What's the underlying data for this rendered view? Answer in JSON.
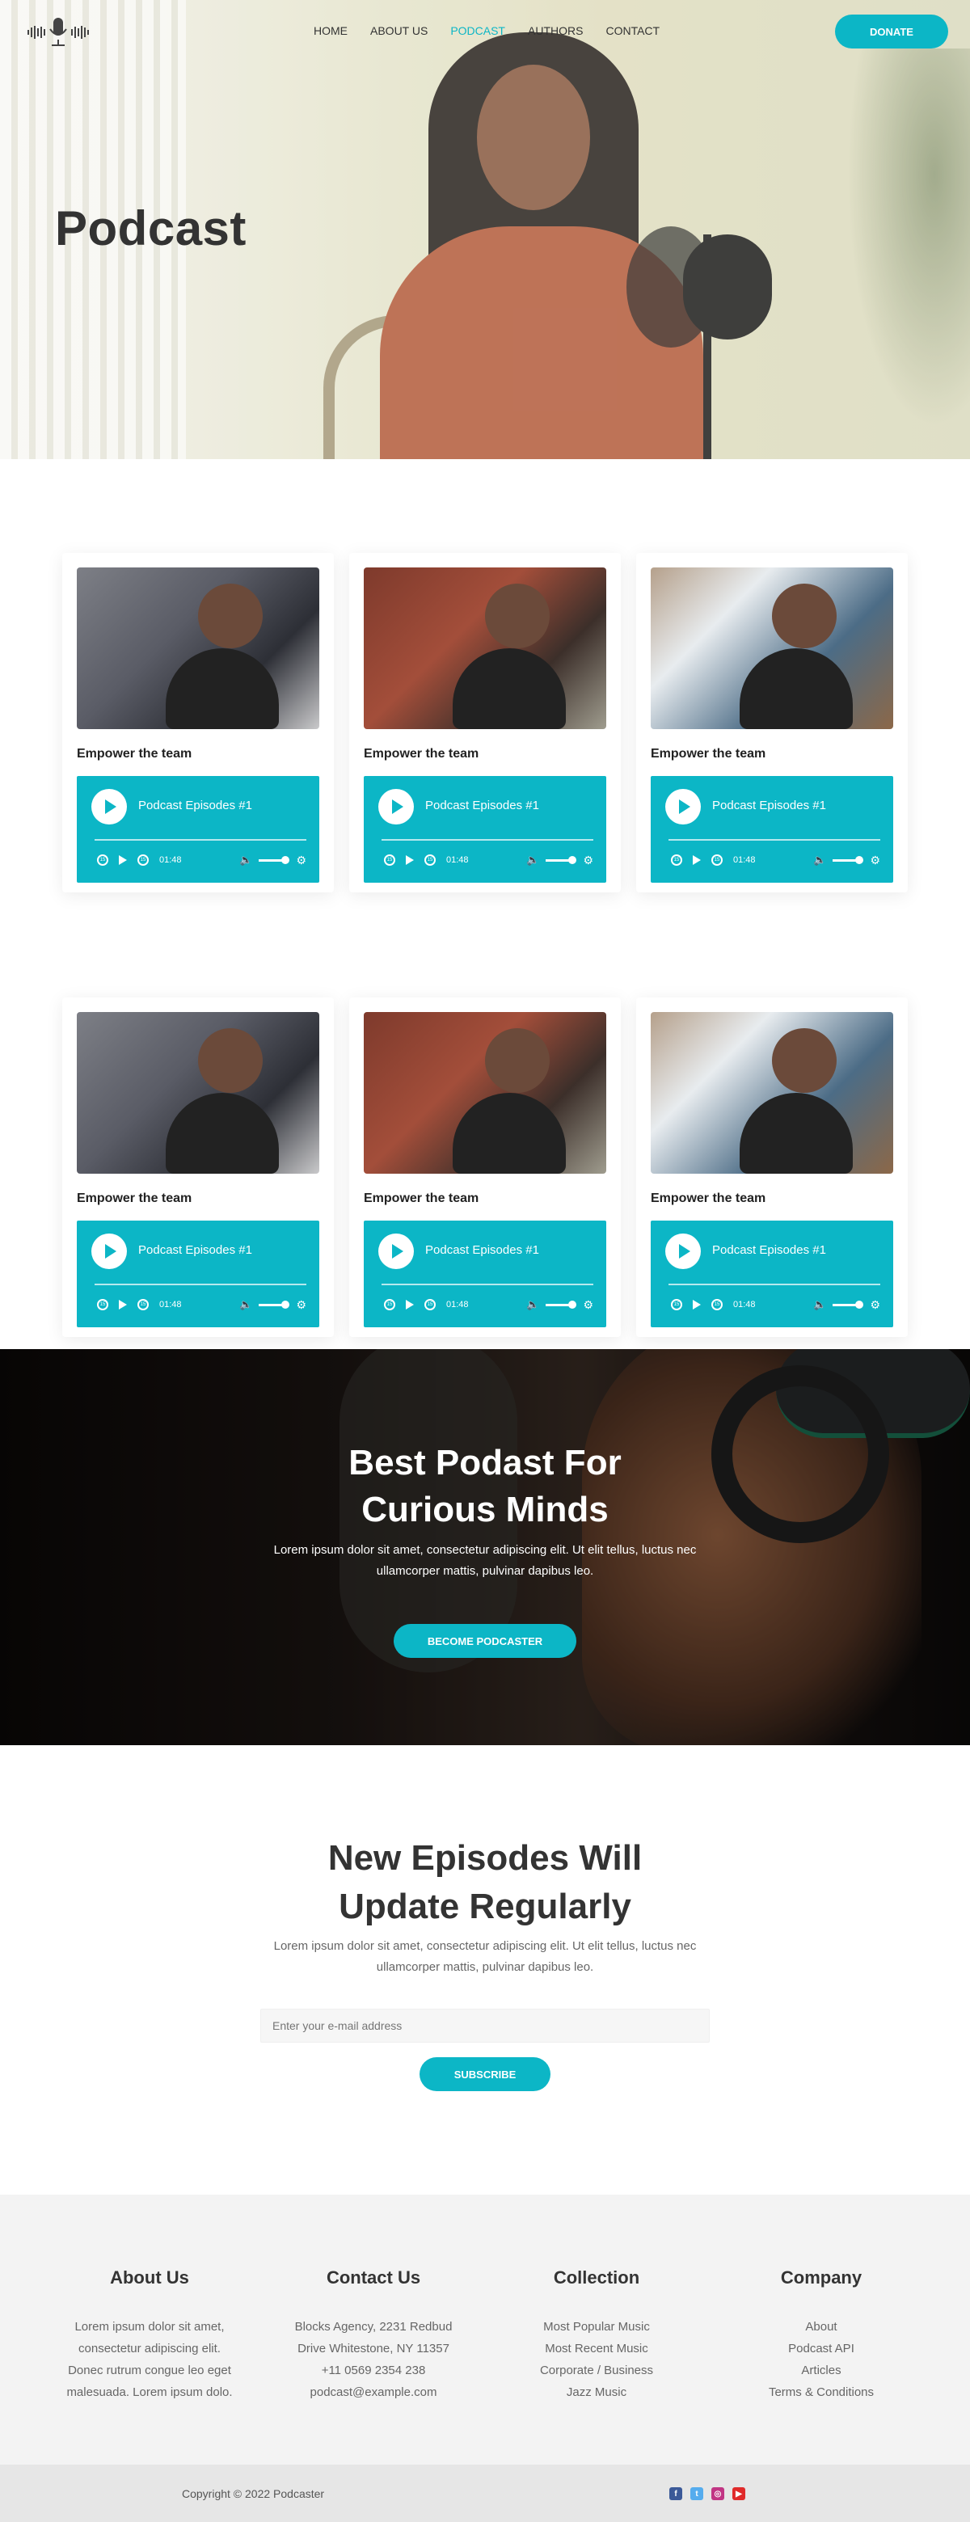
{
  "nav": {
    "items": [
      {
        "label": "HOME",
        "active": false
      },
      {
        "label": "ABOUT US",
        "active": false
      },
      {
        "label": "PODCAST",
        "active": true
      },
      {
        "label": "AUTHORS",
        "active": false
      },
      {
        "label": "CONTACT",
        "active": false
      }
    ],
    "donate_label": "DONATE"
  },
  "hero": {
    "title": "Podcast"
  },
  "cards": [
    {
      "title": "Empower the team",
      "episode": "Podcast Episodes #1",
      "time": "01:48"
    },
    {
      "title": "Empower the team",
      "episode": "Podcast Episodes #1",
      "time": "01:48"
    },
    {
      "title": "Empower the team",
      "episode": "Podcast Episodes #1",
      "time": "01:48"
    },
    {
      "title": "Empower the team",
      "episode": "Podcast Episodes #1",
      "time": "01:48"
    },
    {
      "title": "Empower the team",
      "episode": "Podcast Episodes #1",
      "time": "01:48"
    },
    {
      "title": "Empower the team",
      "episode": "Podcast Episodes #1",
      "time": "01:48"
    }
  ],
  "promo": {
    "title_line1": "Best Podast For",
    "title_line2": "Curious Minds",
    "text": "Lorem ipsum dolor sit amet, consectetur adipiscing elit. Ut elit tellus, luctus nec ullamcorper mattis, pulvinar dapibus leo.",
    "button": "BECOME PODCASTER"
  },
  "newsletter": {
    "title_line1": "New Episodes Will",
    "title_line2": "Update Regularly",
    "text": "Lorem ipsum dolor sit amet, consectetur adipiscing elit. Ut elit tellus, luctus nec ullamcorper mattis, pulvinar dapibus leo.",
    "placeholder": "Enter your e-mail address",
    "button": "SUBSCRIBE"
  },
  "footer": {
    "about": {
      "title": "About Us",
      "lines": [
        "Lorem ipsum dolor sit amet,",
        "consectetur adipiscing elit.",
        "Donec rutrum congue leo eget",
        "malesuada. Lorem ipsum dolo."
      ]
    },
    "contact": {
      "title": "Contact Us",
      "lines": [
        "Blocks Agency, 2231 Redbud",
        "Drive Whitestone, NY 11357",
        "+11 0569 2354 238",
        "podcast@example.com"
      ]
    },
    "collection": {
      "title": "Collection",
      "links": [
        "Most Popular Music",
        "Most Recent Music",
        "Corporate / Business",
        "Jazz Music"
      ]
    },
    "company": {
      "title": "Company",
      "links": [
        "About",
        "Podcast API",
        "Articles",
        "Terms & Conditions"
      ]
    },
    "copyright": "Copyright © 2022 Podcaster",
    "socials": [
      "facebook-icon",
      "twitter-icon",
      "instagram-icon",
      "youtube-icon"
    ]
  },
  "colors": {
    "accent": "#0cb6c6",
    "text": "#333333"
  }
}
